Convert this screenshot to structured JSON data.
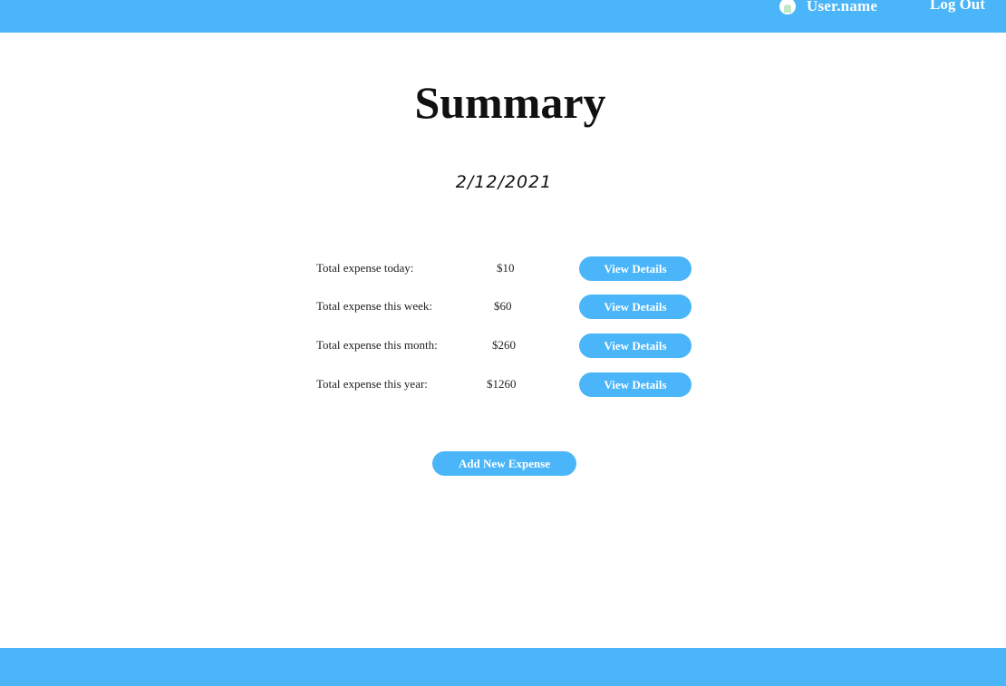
{
  "header": {
    "username": "User.name",
    "logout_label": "Log Out"
  },
  "summary": {
    "title": "Summary",
    "date": "2/12/2021",
    "rows": [
      {
        "label": "Total expense today:",
        "amount": "$10",
        "button": "View Details"
      },
      {
        "label": "Total expense this week:",
        "amount": "$60",
        "button": "View Details"
      },
      {
        "label": "Total expense this month:",
        "amount": "$260",
        "button": "View Details"
      },
      {
        "label": "Total expense this year:",
        "amount": "$1260",
        "button": "View Details"
      }
    ],
    "add_button": "Add New Expense"
  },
  "colors": {
    "accent": "#4ab5f8",
    "background": "#ffffff",
    "text": "#111111"
  },
  "icons": {
    "avatar": "user-avatar-icon"
  }
}
